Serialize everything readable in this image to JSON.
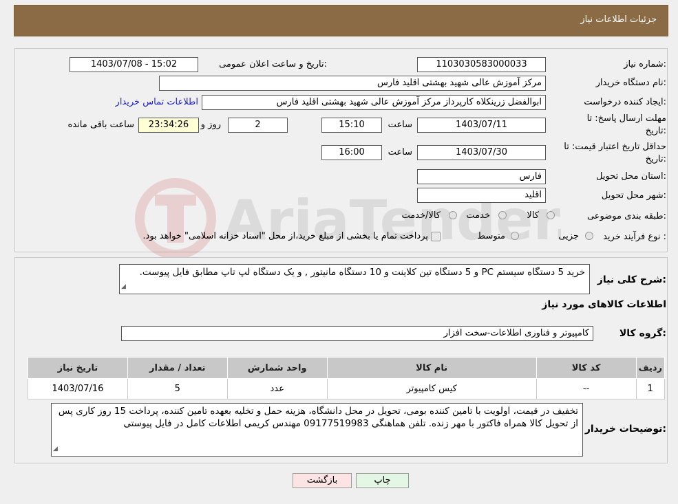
{
  "header": {
    "title": "جزئیات اطلاعات نیاز"
  },
  "form": {
    "need_number_label": "شماره نیاز:",
    "need_number": "1103030583000033",
    "announce_label": "تاریخ و ساعت اعلان عمومی:",
    "announce_value": "1403/07/08 - 15:02",
    "buyer_org_label": "نام دستگاه خریدار:",
    "buyer_org": "مرکز آموزش عالی شهید بهشتی اقلید فارس",
    "creator_label": "ایجاد کننده درخواست:",
    "creator": "ابوالفضل زرینکلاه کارپرداز مرکز آموزش عالی شهید بهشتی اقلید فارس",
    "contact_link": "اطلاعات تماس خریدار",
    "deadline_label_1": "مهلت ارسال پاسخ: تا",
    "deadline_label_2": "تاریخ:",
    "deadline_date": "1403/07/11",
    "time_label": "ساعت",
    "deadline_time": "15:10",
    "days_value": "2",
    "days_label": "روز و",
    "remaining_time": "23:34:26",
    "remaining_label": "ساعت باقی مانده",
    "validity_label_1": "حداقل تاریخ اعتبار قیمت: تا",
    "validity_label_2": "تاریخ:",
    "validity_date": "1403/07/30",
    "validity_time": "16:00",
    "province_label": "استان محل تحویل:",
    "province": "فارس",
    "city_label": "شهر محل تحویل:",
    "city": "اقلید",
    "category_label": "طبقه بندی موضوعی:",
    "category_options": [
      "کالا",
      "خدمت",
      "کالا/خدمت"
    ],
    "purchase_type_label": "نوع فرآیند خرید :",
    "purchase_options": [
      "جزیی",
      "متوسط"
    ],
    "purchase_note": "پرداخت تمام یا بخشی از مبلغ خرید،از محل \"اسناد خزانه اسلامی\" خواهد بود."
  },
  "details": {
    "summary_label": "شرح کلی نیاز:",
    "summary": "خرید 5 دستگاه سیستم PC و 5 دستگاه تین کلاینت و 10 دستگاه مانیتور , و یک دستگاه لپ تاپ مطابق فایل پیوست.",
    "goods_info_title": "اطلاعات کالاهای مورد نیاز",
    "goods_group_label": "گروه کالا:",
    "goods_group": "کامپیوتر و فناوری اطلاعات-سخت افزار",
    "table": {
      "headers": [
        "ردیف",
        "کد کالا",
        "نام کالا",
        "واحد شمارش",
        "تعداد / مقدار",
        "تاریخ نیاز"
      ],
      "rows": [
        [
          "1",
          "--",
          "کیس کامپیوتر",
          "عدد",
          "5",
          "1403/07/16"
        ]
      ]
    },
    "buyer_notes_label": "توضیحات خریدار:",
    "buyer_notes": "تخفیف در قیمت، اولویت با تامین کننده بومی، تحویل در محل دانشگاه، هزینه حمل و تخلیه بعهده تامین کننده، پرداخت 15 روز کاری پس از تحویل کالا همراه فاکتور با مهر زنده. تلفن هماهنگی 09177519983 مهندس کریمی اطلاعات کامل در فایل پیوستی"
  },
  "buttons": {
    "print": "چاپ",
    "back": "بازگشت"
  },
  "watermark": {
    "text": "AriaTender.neT"
  },
  "colors": {
    "header_bg": "#8b6b45",
    "link": "#2222cc",
    "back_button_bg": "#fde4e4",
    "print_button_bg": "#e4f6e4"
  }
}
